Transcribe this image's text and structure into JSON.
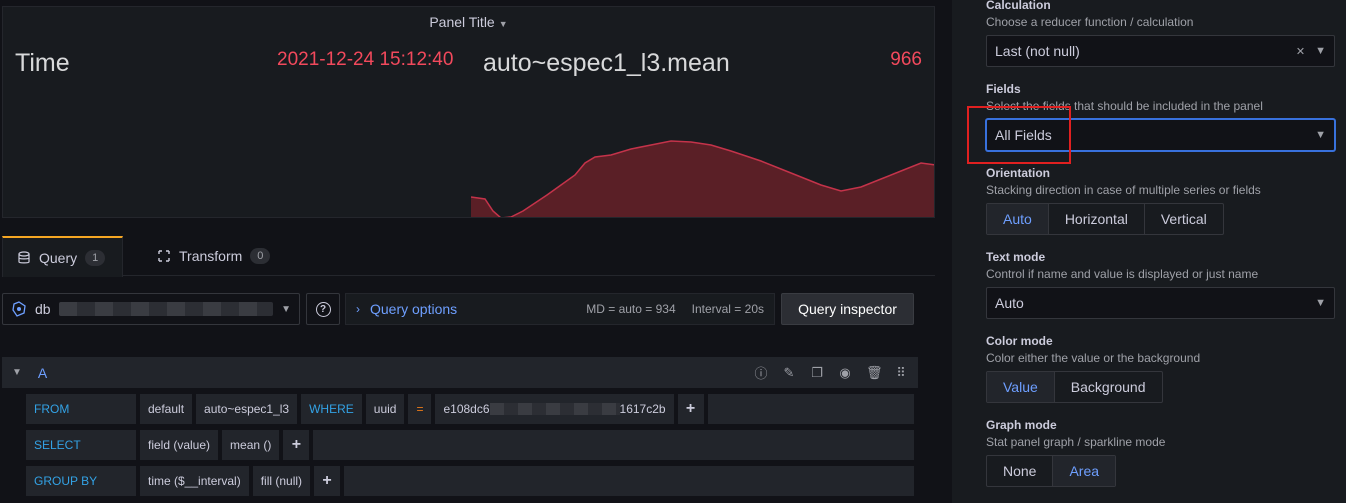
{
  "panel": {
    "title": "Panel Title",
    "stat1": {
      "name": "Time",
      "value": "2021-12-24 15:12:40"
    },
    "stat2": {
      "name": "auto~espec1_l3.mean",
      "value": "966"
    }
  },
  "tabs": [
    {
      "label": "Query",
      "count": "1",
      "icon": "database-icon"
    },
    {
      "label": "Transform",
      "count": "0",
      "icon": "transform-icon"
    }
  ],
  "datasource": {
    "name_visible": "db",
    "icon": "influxdb-icon"
  },
  "query_options": {
    "label": "Query options",
    "md": "MD = auto = 934",
    "interval": "Interval = 20s"
  },
  "query_inspector": "Query inspector",
  "query_a": {
    "letter": "A",
    "from": {
      "kw": "FROM",
      "policy": "default",
      "measurement": "auto~espec1_l3",
      "where": "WHERE",
      "tag": "uuid",
      "op": "=",
      "value_start": "e108dc6",
      "value_end": "1617c2b"
    },
    "select": {
      "kw": "SELECT",
      "field": "field (value)",
      "fn": "mean ()"
    },
    "group_by": {
      "kw": "GROUP BY",
      "time": "time ($__interval)",
      "fill": "fill (null)"
    }
  },
  "options": {
    "calculation": {
      "label": "Calculation",
      "desc": "Choose a reducer function / calculation",
      "value": "Last (not null)"
    },
    "fields": {
      "label": "Fields",
      "desc": "Select the fields that should be included in the panel",
      "value": "All Fields"
    },
    "orientation": {
      "label": "Orientation",
      "desc": "Stacking direction in case of multiple series or fields",
      "choices": [
        "Auto",
        "Horizontal",
        "Vertical"
      ],
      "selected": "Auto"
    },
    "text_mode": {
      "label": "Text mode",
      "desc": "Control if name and value is displayed or just name",
      "value": "Auto"
    },
    "color_mode": {
      "label": "Color mode",
      "desc": "Color either the value or the background",
      "choices": [
        "Value",
        "Background"
      ],
      "selected": "Value"
    },
    "graph_mode": {
      "label": "Graph mode",
      "desc": "Stat panel graph / sparkline mode",
      "choices": [
        "None",
        "Area"
      ],
      "selected": "Area"
    }
  },
  "colors": {
    "accent": "#6e9fff",
    "stat_value": "#f2495c",
    "keyword": "#33a2e5",
    "highlight": "#e02020"
  }
}
